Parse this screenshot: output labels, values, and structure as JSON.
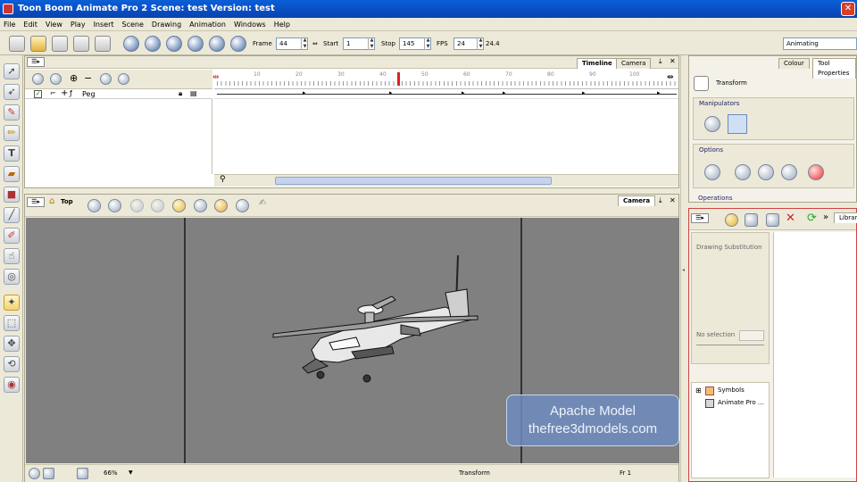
{
  "window": {
    "title": "Toon Boom Animate Pro 2 Scene: test Version: test"
  },
  "menu": [
    "File",
    "Edit",
    "View",
    "Play",
    "Insert",
    "Scene",
    "Drawing",
    "Animation",
    "Windows",
    "Help"
  ],
  "playback": {
    "frame_label": "Frame",
    "frame_value": "44",
    "start_label": "Start",
    "start_value": "1",
    "stop_label": "Stop",
    "stop_value": "145",
    "fps_label": "FPS",
    "fps_value": "24",
    "fps_actual": "24.4"
  },
  "workspace": {
    "value": "Animating"
  },
  "timeline": {
    "tabs": [
      "Timeline",
      "Camera"
    ],
    "layer_name": "Peg",
    "ruler_ticks": [
      "10",
      "20",
      "30",
      "40",
      "50",
      "60",
      "70",
      "80",
      "90",
      "100"
    ],
    "current_frame": 44,
    "total_frames": 145
  },
  "viewport": {
    "view_name": "Top",
    "tab": "Camera",
    "zoom": "66%",
    "tool": "Transform",
    "frame": "Fr 1"
  },
  "tool_properties": {
    "tabs": [
      "Colour",
      "Tool Properties"
    ],
    "tool_name": "Transform",
    "manipulators_label": "Manipulators",
    "options_label": "Options",
    "operations_label": "Operations"
  },
  "library": {
    "tab": "Library",
    "drawing_sub_label": "Drawing Substitution",
    "no_selection_label": "No selection",
    "tree": [
      "Symbols",
      "Animate Pro ..."
    ]
  },
  "watermark": {
    "line1": "Apache Model",
    "line2": "thefree3dmodels.com"
  },
  "colors": {
    "title_bar": "#0a5fd8",
    "stage": "#808080",
    "current_frame_marker": "#e02020"
  }
}
